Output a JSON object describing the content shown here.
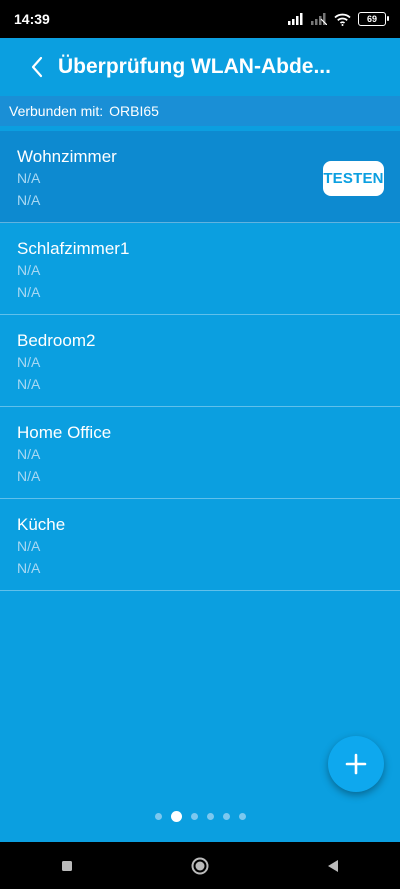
{
  "status_bar": {
    "time": "14:39",
    "battery": "69",
    "icons": [
      "signal-icon",
      "signal-muted-icon",
      "wifi-icon",
      "battery-icon"
    ]
  },
  "header": {
    "title": "Überprüfung WLAN-Abde..."
  },
  "connection": {
    "label": "Verbunden mit:",
    "ssid": "ORBI65"
  },
  "rooms": [
    {
      "name": "Wohnzimmer",
      "line1": "N/A",
      "line2": "N/A",
      "selected": true,
      "action": "TESTEN"
    },
    {
      "name": "Schlafzimmer1",
      "line1": "N/A",
      "line2": "N/A"
    },
    {
      "name": "Bedroom2",
      "line1": "N/A",
      "line2": "N/A"
    },
    {
      "name": "Home Office",
      "line1": "N/A",
      "line2": "N/A"
    },
    {
      "name": "Küche",
      "line1": "N/A",
      "line2": "N/A"
    }
  ],
  "pager": {
    "count": 6,
    "active": 2
  },
  "colors": {
    "background": "#0b9fe0",
    "selected_row": "#0d8ad0",
    "secondary_text": "#a8d8f3"
  }
}
